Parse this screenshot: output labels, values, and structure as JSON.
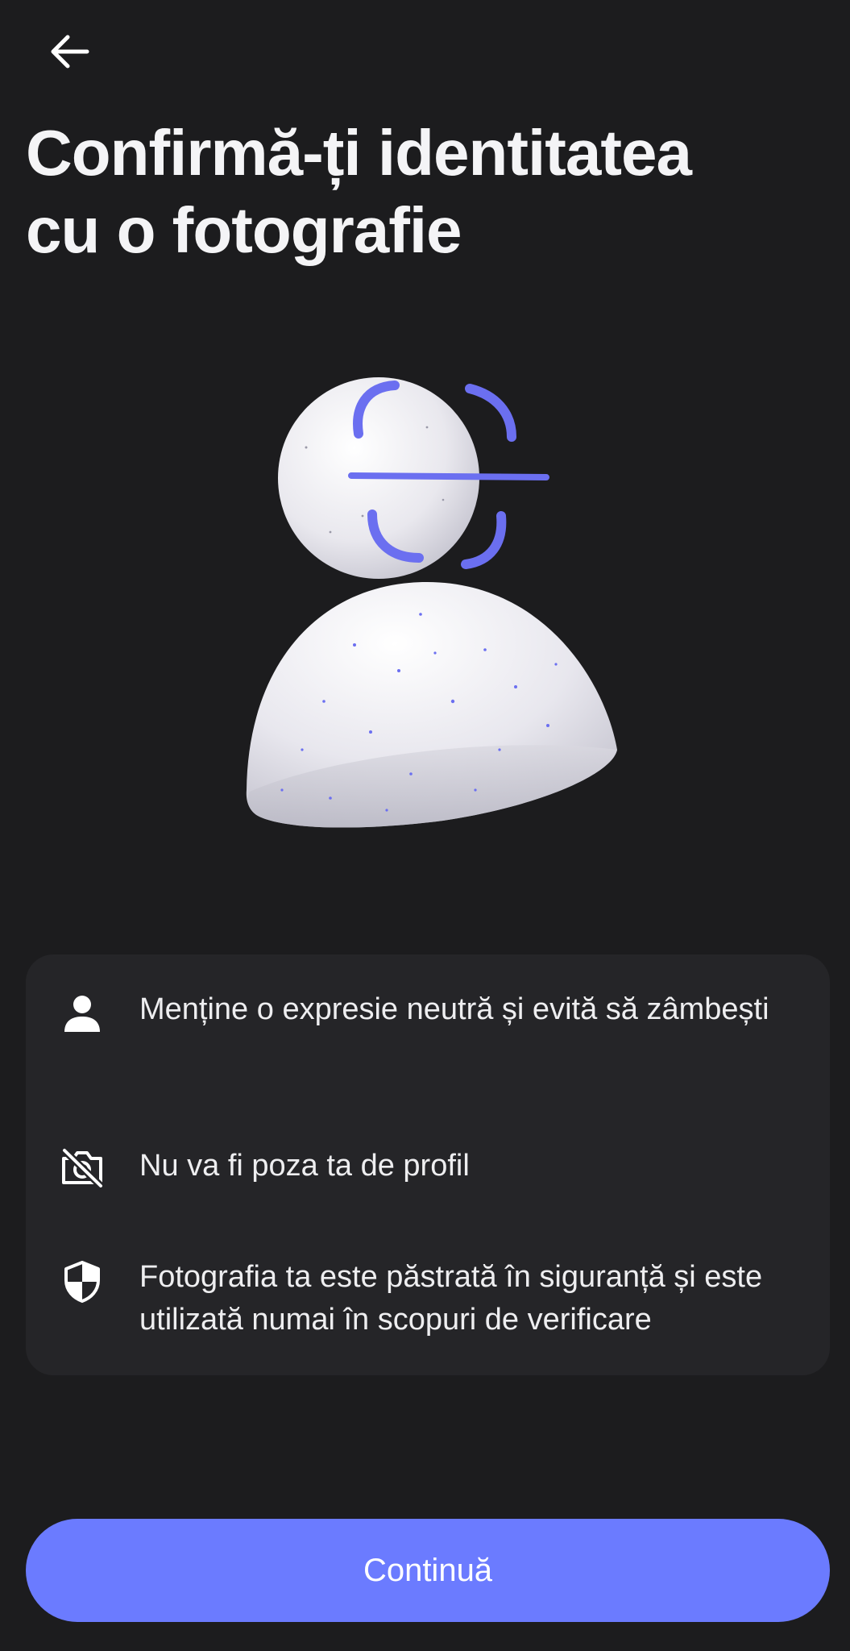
{
  "header": {
    "back_icon": "arrow-left-icon",
    "title": "Confirmă-ți identitatea\ncu o fotografie"
  },
  "hero": {
    "illustration": "face-scan-person-illustration",
    "accent_color": "#6b6ff0"
  },
  "info": {
    "items": [
      {
        "icon": "person-icon",
        "text": "Menține o expresie neutră și evită să zâmbești"
      },
      {
        "icon": "camera-off-icon",
        "text": "Nu va fi poza ta de profil"
      },
      {
        "icon": "shield-icon",
        "text": "Fotografia ta este păstrată în siguranță și este utilizată numai în scopuri de verificare"
      }
    ]
  },
  "footer": {
    "continue_label": "Continuă",
    "button_color": "#6b7bff"
  }
}
